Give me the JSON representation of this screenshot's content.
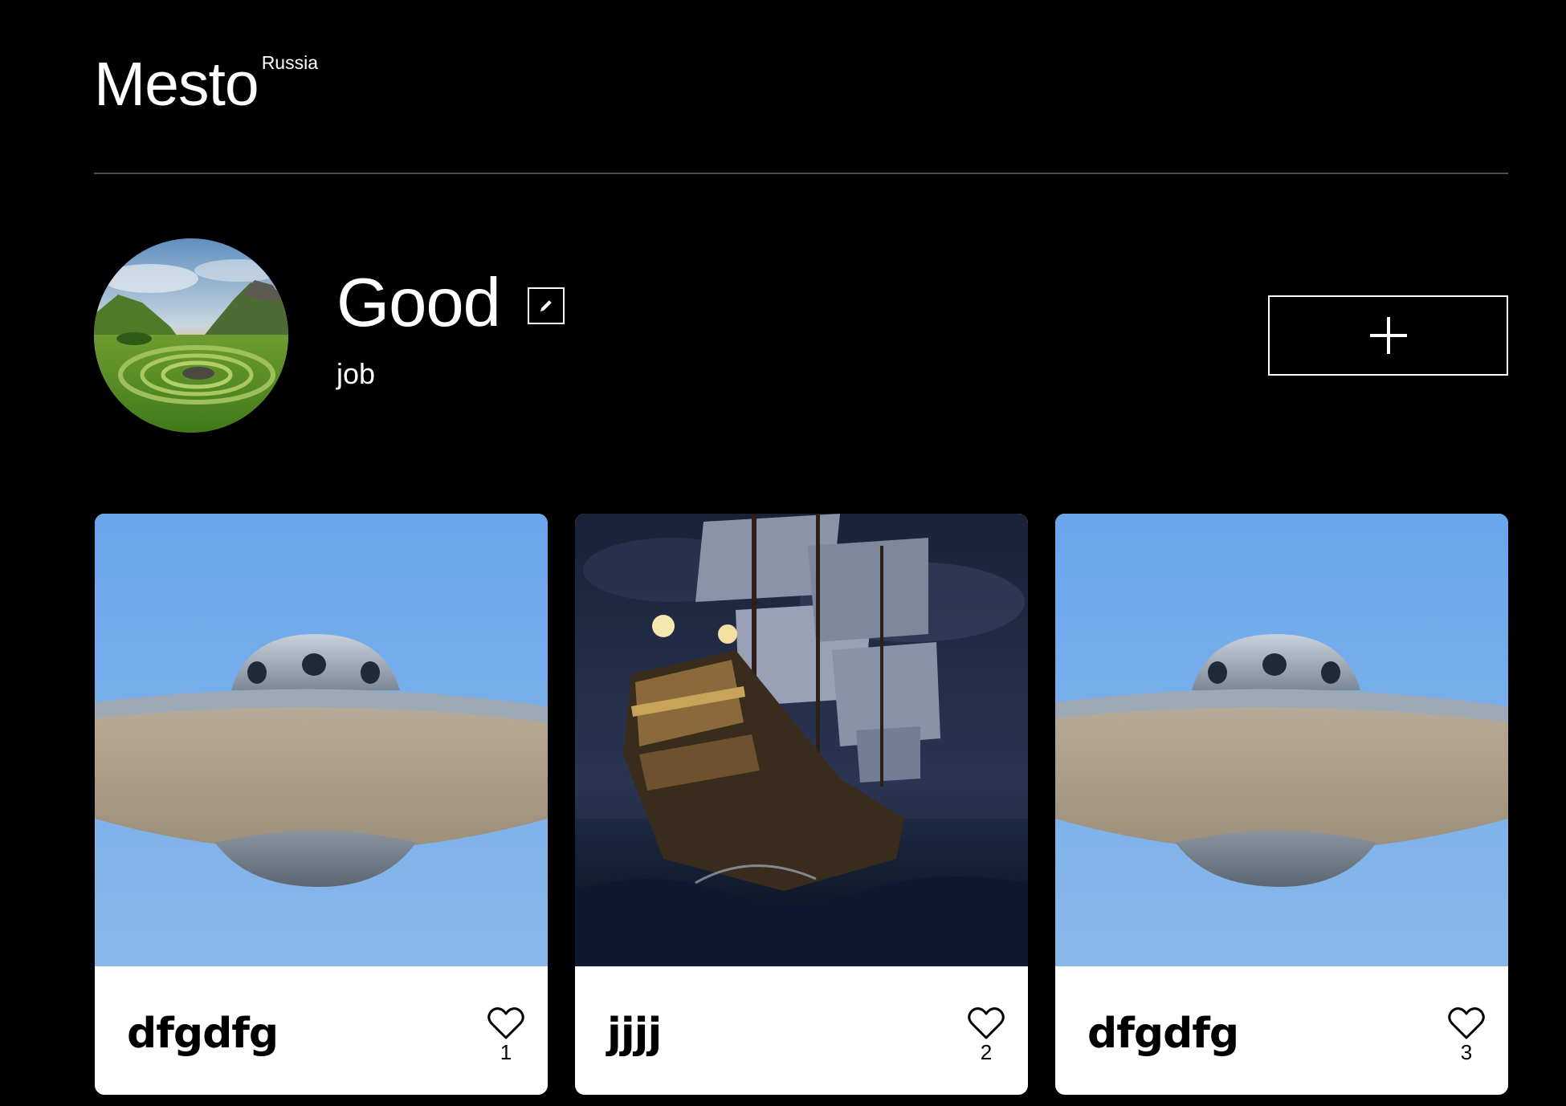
{
  "header": {
    "logo": "Mesto",
    "logo_sup": "Russia"
  },
  "profile": {
    "name": "Good",
    "job": "job",
    "edit_icon": "pencil-icon",
    "add_icon": "plus-icon"
  },
  "cards": [
    {
      "title": "dfgdfg",
      "likes": "1",
      "image": "flying-saucer"
    },
    {
      "title": "jjjj",
      "likes": "2",
      "image": "sailing-ship-at-night"
    },
    {
      "title": "dfgdfg",
      "likes": "3",
      "image": "flying-saucer"
    }
  ],
  "colors": {
    "background": "#000000",
    "card": "#ffffff",
    "divider": "#545454",
    "sky": "#6fa7e8"
  }
}
